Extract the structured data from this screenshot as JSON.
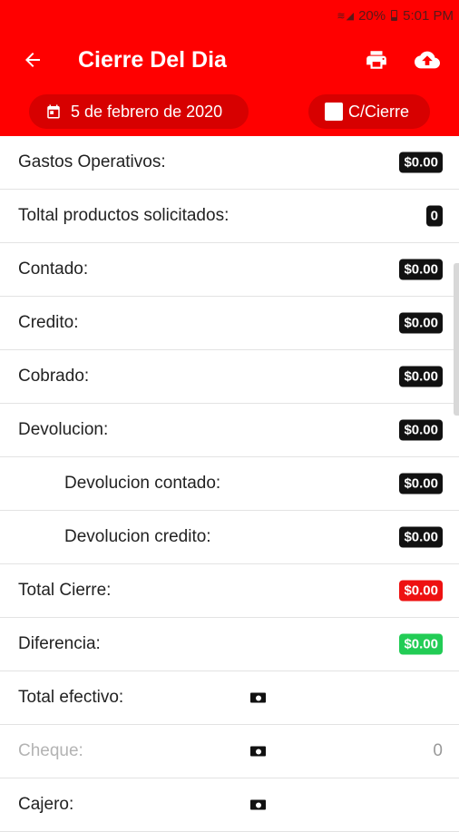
{
  "status_bar": {
    "battery": "20%",
    "time": "5:01 PM"
  },
  "toolbar": {
    "title": "Cierre Del Dia"
  },
  "filters": {
    "date": "5 de febrero de 2020",
    "c_cierre_label": "C/Cierre"
  },
  "rows": [
    {
      "label": "Gastos Operativos:",
      "value": "$0.00"
    },
    {
      "label": "Toltal productos solicitados:",
      "value": "0"
    },
    {
      "label": "Contado:",
      "value": "$0.00"
    },
    {
      "label": "Credito:",
      "value": "$0.00"
    },
    {
      "label": "Cobrado:",
      "value": "$0.00"
    },
    {
      "label": "Devolucion:",
      "value": "$0.00"
    },
    {
      "label": "Devolucion contado:",
      "value": "$0.00"
    },
    {
      "label": "Devolucion credito:",
      "value": "$0.00"
    },
    {
      "label": "Total Cierre:",
      "value": "$0.00"
    },
    {
      "label": "Diferencia:",
      "value": "$0.00"
    }
  ],
  "inputs": [
    {
      "label": "Total efectivo:",
      "value": ""
    },
    {
      "label": "Cheque:",
      "value": "0"
    },
    {
      "label": "Cajero:",
      "value": ""
    }
  ],
  "colors": {
    "appbar": "#ff0000",
    "badge_default": "#111111",
    "badge_total": "#ee1111",
    "badge_diff": "#22cc55"
  }
}
